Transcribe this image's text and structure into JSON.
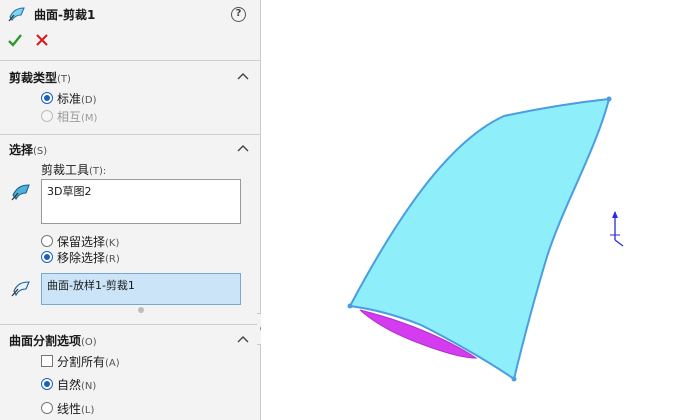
{
  "header": {
    "title": "曲面-剪裁1",
    "help_glyph": "?",
    "title_icon": "surface-trim-icon",
    "ok_icon": "check-icon",
    "cancel_icon": "close-icon"
  },
  "trim_type": {
    "title": "剪裁类型",
    "title_accel": "(T)",
    "options": [
      {
        "label": "标准",
        "accel": "(D)",
        "selected": true,
        "enabled": true
      },
      {
        "label": "相互",
        "accel": "(M)",
        "selected": false,
        "enabled": false
      }
    ]
  },
  "selections": {
    "title": "选择",
    "title_accel": "(S)",
    "trim_tool_label": "剪裁工具",
    "trim_tool_accel": "(T):",
    "trim_tool_value": "3D草图2",
    "keep_remove": [
      {
        "label": "保留选择",
        "accel": "(K)",
        "selected": false
      },
      {
        "label": "移除选择",
        "accel": "(R)",
        "selected": true
      }
    ],
    "remove_list_value": "曲面-放样1-剪裁1"
  },
  "split_options": {
    "title": "曲面分割选项",
    "title_accel": "(O)",
    "split_all_label": "分割所有",
    "split_all_accel": "(A)",
    "split_all_checked": false,
    "options": [
      {
        "label": "自然",
        "accel": "(N)",
        "selected": true
      },
      {
        "label": "线性",
        "accel": "(L)",
        "selected": false
      }
    ]
  },
  "colors": {
    "surface_fill": "#8eeefa",
    "surface_edge": "#4a9de0",
    "selected_face": "#d43cf0",
    "accent": "#1b5fbf",
    "ok_green": "#2e9a2e",
    "cancel_red": "#d42020"
  }
}
